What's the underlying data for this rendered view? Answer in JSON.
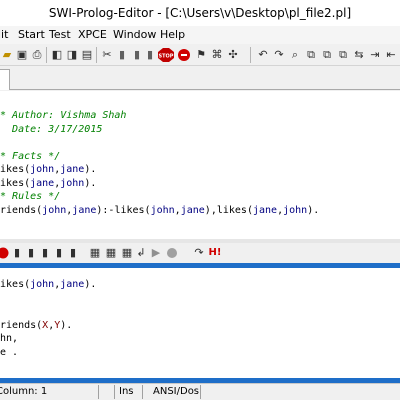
{
  "window": {
    "title": "SWI-Prolog-Editor - [C:\\Users\\v\\Desktop\\pl_file2.pl]"
  },
  "menu": [
    "lit",
    "Start",
    "Test",
    "XPCE",
    "Window",
    "Help"
  ],
  "toolbar": {
    "icons": [
      "open-folder-icon",
      "save-icon",
      "print-icon",
      "undo-icon",
      "redo-icon",
      "delete-icon",
      "copy-icon",
      "cut-icon",
      "paste-icon",
      "find-icon",
      "check-icon",
      "clear-icon",
      "compile-icon",
      "stop-icon",
      "reload-icon",
      "help-icon",
      "run-icon",
      "consult-icon",
      "query-icon",
      "settings-icon",
      "indent-icon",
      "outdent-icon"
    ]
  },
  "editor": {
    "lines": [
      [
        {
          "t": "/* Author: Vishma Shah",
          "c": "comment"
        }
      ],
      [
        {
          "t": "   Date: 3/17/2015",
          "c": "comment"
        }
      ],
      [],
      [
        {
          "t": "/* Facts */",
          "c": "comment"
        }
      ],
      [
        {
          "t": "likes(",
          "c": "fn"
        },
        {
          "t": "john",
          "c": "atom"
        },
        {
          "t": ",",
          "c": "fn"
        },
        {
          "t": "jane",
          "c": "atom"
        },
        {
          "t": ").",
          "c": "fn"
        }
      ],
      [
        {
          "t": "likes(",
          "c": "fn"
        },
        {
          "t": "jane",
          "c": "atom"
        },
        {
          "t": ",",
          "c": "fn"
        },
        {
          "t": "john",
          "c": "atom"
        },
        {
          "t": ").",
          "c": "fn"
        }
      ],
      [
        {
          "t": "/* Rules */",
          "c": "comment"
        }
      ],
      [
        {
          "t": "friends(",
          "c": "fn"
        },
        {
          "t": "john",
          "c": "atom"
        },
        {
          "t": ",",
          "c": "fn"
        },
        {
          "t": "jane",
          "c": "atom"
        },
        {
          "t": "):-likes(",
          "c": "fn"
        },
        {
          "t": "john",
          "c": "atom"
        },
        {
          "t": ",",
          "c": "fn"
        },
        {
          "t": "jane",
          "c": "atom"
        },
        {
          "t": "),likes(",
          "c": "fn"
        },
        {
          "t": "jane",
          "c": "atom"
        },
        {
          "t": ",",
          "c": "fn"
        },
        {
          "t": "john",
          "c": "atom"
        },
        {
          "t": ").",
          "c": "fn"
        }
      ]
    ]
  },
  "toolbar2": {
    "icons": [
      "stop-icon",
      "breakpoint-icon",
      "step-into-icon",
      "step-over-icon",
      "step-out-icon",
      "watch-icon",
      "variables-icon",
      "stack-icon",
      "trace-icon",
      "run-icon",
      "record-icon",
      "refresh-icon",
      "halt-icon"
    ],
    "halt_label": "H!"
  },
  "console": {
    "lines": [
      [
        {
          "t": "likes(",
          "c": "fn"
        },
        {
          "t": "john",
          "c": "atom"
        },
        {
          "t": ",",
          "c": "fn"
        },
        {
          "t": "jane",
          "c": "atom"
        },
        {
          "t": ").",
          "c": "fn"
        }
      ],
      [],
      [],
      [
        {
          "t": "friends(",
          "c": "fn"
        },
        {
          "t": "X",
          "c": "var"
        },
        {
          "t": ",",
          "c": "fn"
        },
        {
          "t": "Y",
          "c": "var"
        },
        {
          "t": ").",
          "c": "fn"
        }
      ],
      [
        {
          "t": "ohn,",
          "c": "fn"
        }
      ],
      [
        {
          "t": "ne .",
          "c": "fn"
        }
      ]
    ]
  },
  "status": {
    "column": "Column: 1",
    "mode": "Ins",
    "encoding": "ANSI/Dos"
  }
}
